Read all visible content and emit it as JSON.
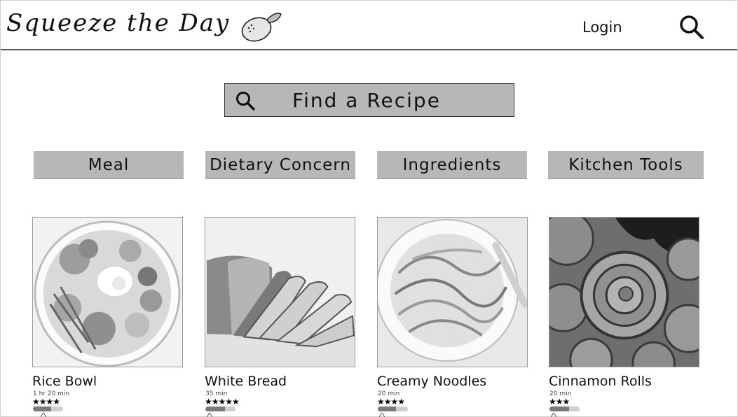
{
  "header": {
    "logo_text": "Squeeze the Day",
    "logo_icon": "lemon-icon",
    "login_label": "Login",
    "search_icon": "search-icon"
  },
  "find_recipe": {
    "label": "Find a Recipe",
    "icon": "search-icon"
  },
  "categories": [
    {
      "label": "Meal"
    },
    {
      "label": "Dietary Concern"
    },
    {
      "label": "Ingredients"
    },
    {
      "label": "Kitchen Tools"
    }
  ],
  "recipes": [
    {
      "title": "Rice Bowl",
      "time": "1 hr 20 min",
      "stars": "★★★★",
      "rating": 4,
      "difficulty": 0.6
    },
    {
      "title": "White Bread",
      "time": "35 min",
      "stars": "★★★★★",
      "rating": 5,
      "difficulty": 0.65
    },
    {
      "title": "Creamy Noodles",
      "time": "20 min",
      "stars": "★★★★",
      "rating": 4,
      "difficulty": 0.6
    },
    {
      "title": "Cinnamon Rolls",
      "time": "20 min",
      "stars": "★★★",
      "rating": 3,
      "difficulty": 0.65
    }
  ],
  "colors": {
    "button_gray": "#b7b7b7",
    "meter_fill": "#7a7a7a",
    "meter_track": "#cfcfcf"
  }
}
